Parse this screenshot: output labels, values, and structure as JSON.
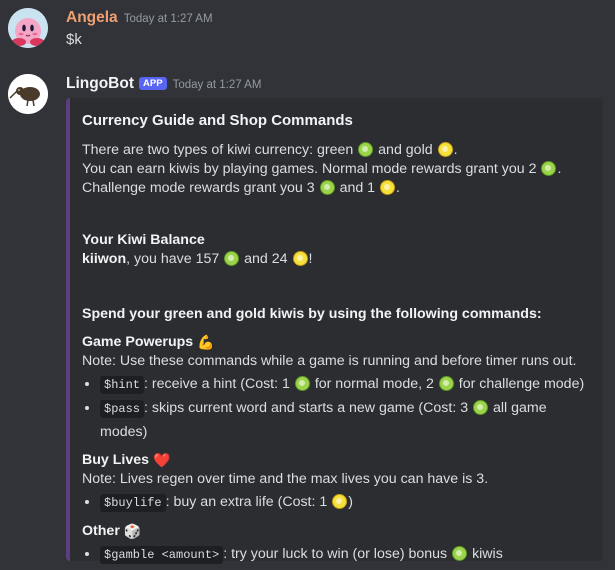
{
  "message1": {
    "username": "Angela",
    "username_color": "#f0a070",
    "timestamp": "Today at 1:27 AM",
    "content": "$k"
  },
  "message2": {
    "username": "LingoBot",
    "tag": "APP",
    "timestamp": "Today at 1:27 AM",
    "embed": {
      "accent_color": "#5d3e7e",
      "title": "Currency Guide and Shop Commands",
      "intro": {
        "l1a": "There are two types of kiwi currency: green",
        "l1b": "and gold",
        "l1c": ".",
        "l2a": "You can earn kiwis by playing games. Normal mode rewards grant you 2",
        "l2b": ".",
        "l3a": "Challenge mode rewards grant you 3",
        "l3b": "and 1",
        "l3c": "."
      },
      "balance": {
        "heading": "Your Kiwi Balance",
        "user": "kiiwon",
        "text_a": ", you have 157",
        "text_b": "and 24",
        "text_c": "!"
      },
      "spend_heading": "Spend your green and gold kiwis by using the following commands:",
      "powerups": {
        "heading": "Game Powerups",
        "emoji": "💪",
        "note": "Note: Use these commands while a game is running and before timer runs out.",
        "hint": {
          "cmd": "$hint",
          "a": ": receive a hint (Cost: 1",
          "b": "for normal mode, 2",
          "c": "for challenge mode)"
        },
        "pass": {
          "cmd": "$pass",
          "a": ": skips current word and starts a new game (Cost: 3",
          "b": "all game modes)"
        }
      },
      "lives": {
        "heading": "Buy Lives",
        "emoji": "❤️",
        "note": "Note: Lives regen over time and the max lives you can have is 3.",
        "buylife": {
          "cmd": "$buylife",
          "a": ": buy an extra life (Cost: 1",
          "b": ")"
        }
      },
      "other": {
        "heading": "Other",
        "emoji": "🎲",
        "gamble": {
          "cmd": "$gamble <amount>",
          "a": ": try your luck to win (or lose) bonus",
          "b": "kiwis"
        }
      }
    }
  },
  "colors": {
    "background": "#313338",
    "embed_bg": "#2b2d31",
    "green_kiwi": "#9bd44a",
    "gold_kiwi": "#f6e03c",
    "app_tag": "#5865f2"
  }
}
